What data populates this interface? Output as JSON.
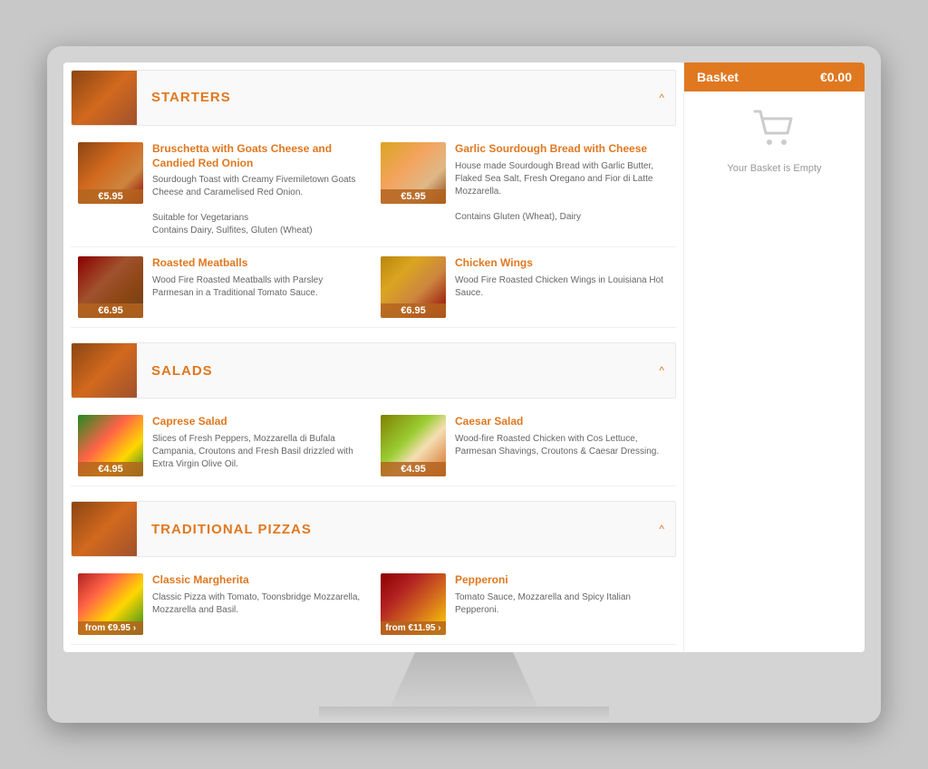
{
  "sections": {
    "starters": {
      "title": "STARTERS",
      "items": [
        {
          "name": "Bruschetta with Goats Cheese and Candied Red Onion",
          "desc": "Sourdough Toast with Creamy Fivemiletown Goats Cheese and Caramelised Red Onion.\n\nSuitable for Vegetarians\nContains Dairy, Sulfites, Gluten (Wheat)",
          "price": "€5.95",
          "from": false,
          "img_class": "food-bruschetta"
        },
        {
          "name": "Garlic Sourdough Bread with Cheese",
          "desc": "House made Sourdough Bread with Garlic Butter, Flaked Sea Salt, Fresh Oregano and Fior di Latte Mozzarella.\n\nContains Gluten (Wheat), Dairy",
          "price": "€5.95",
          "from": false,
          "img_class": "food-garlic"
        },
        {
          "name": "Roasted Meatballs",
          "desc": "Wood Fire Roasted Meatballs with Parsley Parmesan in a Traditional Tomato Sauce.",
          "price": "€6.95",
          "from": false,
          "img_class": "food-meatballs"
        },
        {
          "name": "Chicken Wings",
          "desc": "Wood Fire Roasted Chicken Wings in Louisiana Hot Sauce.",
          "price": "€6.95",
          "from": false,
          "img_class": "food-chicken"
        }
      ]
    },
    "salads": {
      "title": "SALADS",
      "items": [
        {
          "name": "Caprese Salad",
          "desc": "Slices of Fresh Peppers, Mozzarella di Bufala Campania, Croutons and Fresh Basil drizzled with Extra Virgin Olive Oil.",
          "price": "€4.95",
          "from": false,
          "img_class": "food-caprese"
        },
        {
          "name": "Caesar Salad",
          "desc": "Wood-fire Roasted Chicken with Cos Lettuce, Parmesan Shavings, Croutons & Caesar Dressing.",
          "price": "€4.95",
          "from": false,
          "img_class": "food-caesar"
        }
      ]
    },
    "pizzas": {
      "title": "TRADITIONAL PIZZAS",
      "items": [
        {
          "name": "Classic Margherita",
          "desc": "Classic Pizza with Tomato, Toonsbridge Mozzarella, Mozzarella and Basil.",
          "price": "from €9.95 ›",
          "from": true,
          "img_class": "food-margherita"
        },
        {
          "name": "Pepperoni",
          "desc": "Tomato Sauce, Mozzarella and Spicy Italian Pepperoni.",
          "price": "from €11.95 ›",
          "from": true,
          "img_class": "food-pepperoni"
        }
      ]
    }
  },
  "basket": {
    "title": "Basket",
    "total": "€0.00",
    "empty_text": "Your Basket is Empty"
  },
  "chevron_up": "^"
}
